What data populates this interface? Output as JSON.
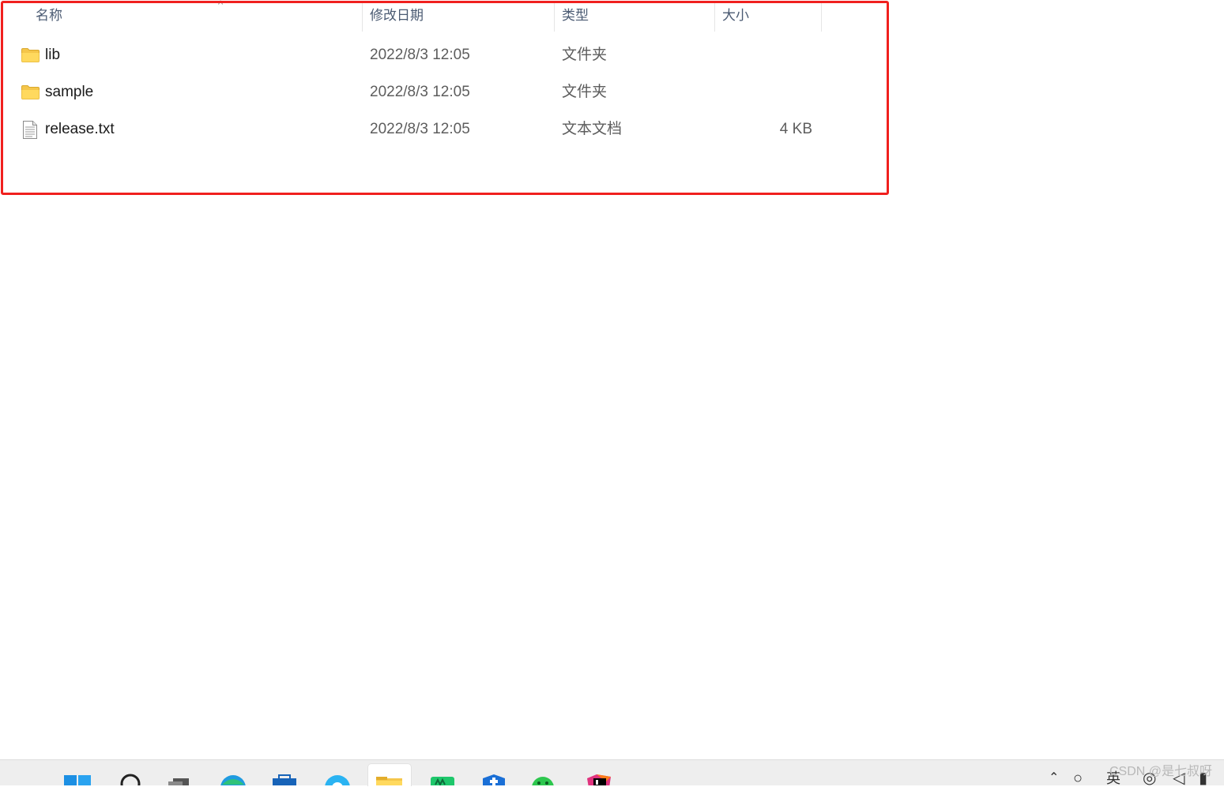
{
  "columns": {
    "name": "名称",
    "modified": "修改日期",
    "type": "类型",
    "size": "大小"
  },
  "sort_indicator": "^",
  "files": [
    {
      "name": "lib",
      "modified": "2022/8/3 12:05",
      "type": "文件夹",
      "size": "",
      "icon": "folder-icon"
    },
    {
      "name": "sample",
      "modified": "2022/8/3 12:05",
      "type": "文件夹",
      "size": "",
      "icon": "folder-icon"
    },
    {
      "name": "release.txt",
      "modified": "2022/8/3 12:05",
      "type": "文本文档",
      "size": "4 KB",
      "icon": "text-file-icon"
    }
  ],
  "highlight_color": "#f0201e",
  "taskbar": {
    "apps": [
      "start-icon",
      "search-icon",
      "task-view-icon",
      "edge-icon",
      "store-icon",
      "app-icon",
      "file-explorer-icon",
      "green-app-icon",
      "security-icon",
      "wechat-icon",
      "intellij-icon"
    ],
    "tray": {
      "ime_label": "英"
    }
  },
  "watermark": "CSDN @是七叔呀"
}
